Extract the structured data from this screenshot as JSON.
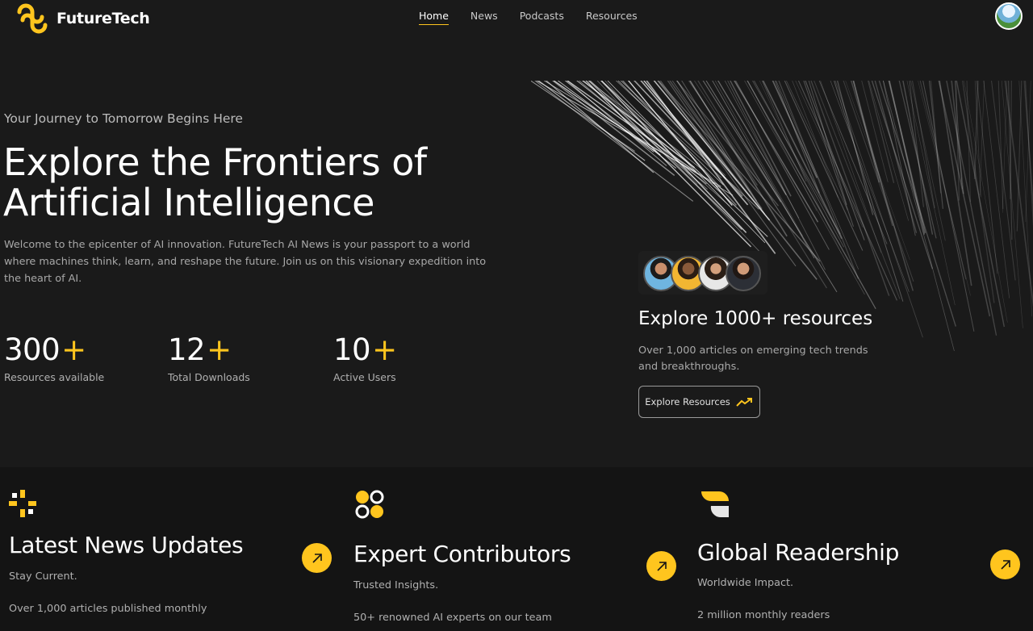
{
  "header": {
    "logo_text": "FutureTech",
    "nav": [
      {
        "label": "Home",
        "active": true
      },
      {
        "label": "News",
        "active": false
      },
      {
        "label": "Podcasts",
        "active": false
      },
      {
        "label": "Resources",
        "active": false
      }
    ]
  },
  "hero": {
    "tagline": "Your Journey to Tomorrow Begins Here",
    "title_line1": "Explore the Frontiers of",
    "title_line2": "Artificial Intelligence",
    "description": "Welcome to the epicenter of AI innovation. FutureTech AI News is your passport to a world where machines think, learn, and reshape the future. Join us on this visionary expedition into the heart of AI."
  },
  "stats": [
    {
      "value": "300",
      "suffix": "+",
      "label": "Resources available"
    },
    {
      "value": "12",
      "suffix": "+",
      "label": "Total Downloads"
    },
    {
      "value": "10",
      "suffix": "+",
      "label": "Active Users"
    }
  ],
  "explore": {
    "title": "Explore 1000+ resources",
    "description": "Over 1,000 articles on emerging tech trends and breakthroughs.",
    "button_label": "Explore Resources"
  },
  "features": [
    {
      "title": "Latest News Updates",
      "subtitle": "Stay Current.",
      "detail": "Over 1,000 articles published monthly",
      "icon": "sparkle-icon"
    },
    {
      "title": "Expert Contributors",
      "subtitle": "Trusted Insights.",
      "detail": "50+ renowned AI experts on our team",
      "icon": "circles-icon"
    },
    {
      "title": "Global Readership",
      "subtitle": "Worldwide Impact.",
      "detail": "2 million monthly readers",
      "icon": "leaf-icon"
    }
  ],
  "colors": {
    "accent": "#ffc51e",
    "background": "#1a1a1a",
    "section_bg": "#141414"
  }
}
